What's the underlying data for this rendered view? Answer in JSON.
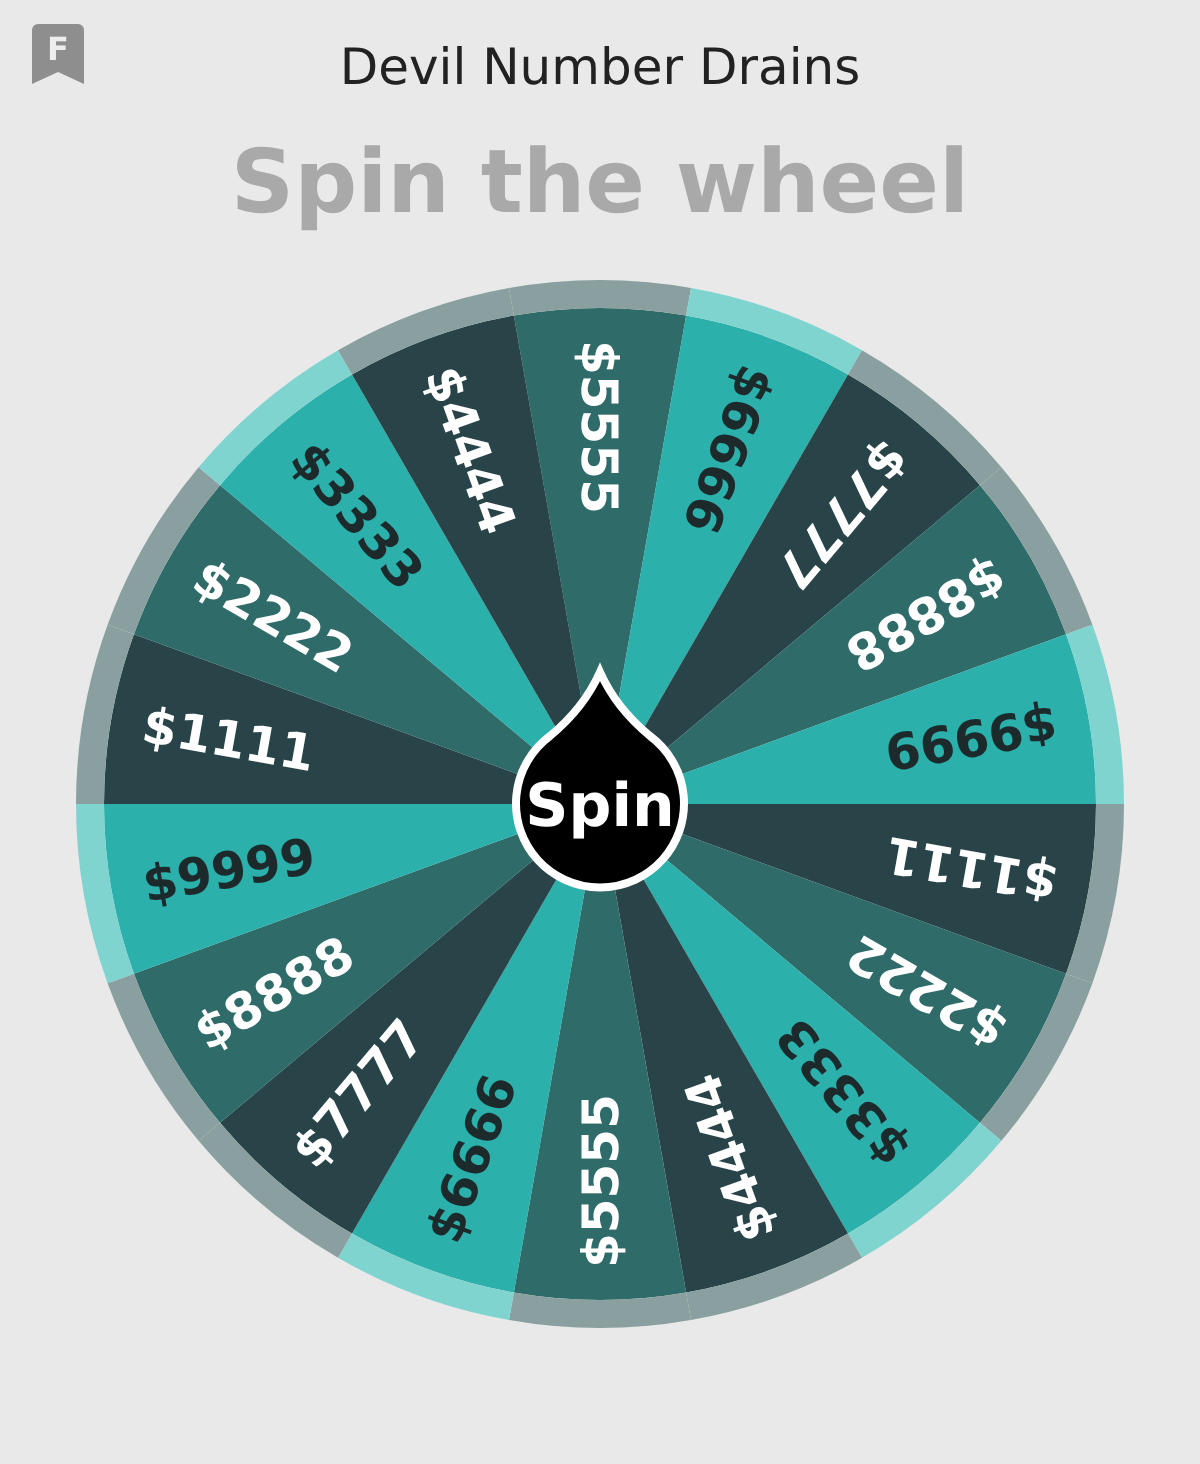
{
  "logo_letter": "F",
  "title": "Devil Number Drains",
  "subtitle": "Spin the wheel",
  "wheel": {
    "segments": [
      {
        "label": "$5555",
        "color": "#2e6b69"
      },
      {
        "label": "$6666",
        "color": "#2bb0ab"
      },
      {
        "label": "$7777",
        "color": "#284449"
      },
      {
        "label": "$8888",
        "color": "#2e6b69"
      },
      {
        "label": "$9999",
        "color": "#2bb0ab"
      },
      {
        "label": "$1111",
        "color": "#284449"
      },
      {
        "label": "$2222",
        "color": "#2e6b69"
      },
      {
        "label": "$3333",
        "color": "#2bb0ab"
      },
      {
        "label": "$4444",
        "color": "#284449"
      },
      {
        "label": "$5555",
        "color": "#2e6b69"
      },
      {
        "label": "$6666",
        "color": "#2bb0ab"
      },
      {
        "label": "$7777",
        "color": "#284449"
      },
      {
        "label": "$8888",
        "color": "#2e6b69"
      },
      {
        "label": "$9999",
        "color": "#2bb0ab"
      },
      {
        "label": "$1111",
        "color": "#284449"
      },
      {
        "label": "$2222",
        "color": "#2e6b69"
      },
      {
        "label": "$3333",
        "color": "#2bb0ab"
      },
      {
        "label": "$4444",
        "color": "#284449"
      }
    ],
    "button": "Spin"
  }
}
